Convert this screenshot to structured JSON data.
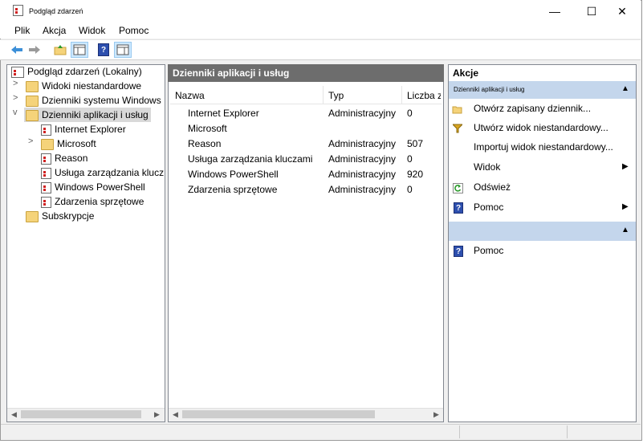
{
  "window": {
    "title": "Podgląd zdarzeń",
    "minimize_symbol": "—",
    "maximize_symbol": "☐",
    "close_symbol": "✕"
  },
  "menu": {
    "items": [
      "Plik",
      "Akcja",
      "Widok",
      "Pomoc"
    ]
  },
  "toolbar": {
    "icons": [
      "back-arrow-icon",
      "forward-arrow-icon",
      "up-folder-icon",
      "console-tree-icon",
      "help-icon",
      "show-hide-action-pane-icon"
    ]
  },
  "tree": {
    "root": "Podgląd zdarzeń (Lokalny)",
    "items": [
      {
        "label": "Widoki niestandardowe",
        "expander": ">"
      },
      {
        "label": "Dzienniki systemu Windows",
        "expander": ">"
      },
      {
        "label": "Dzienniki aplikacji i usług",
        "expander": "v"
      },
      {
        "label": "Internet Explorer"
      },
      {
        "label": "Microsoft",
        "expander": ">"
      },
      {
        "label": "Reason"
      },
      {
        "label": "Usługa zarządzania klucza"
      },
      {
        "label": "Windows PowerShell"
      },
      {
        "label": "Zdarzenia sprzętowe"
      },
      {
        "label": "Subskrypcje"
      }
    ]
  },
  "center": {
    "header": "Dzienniki aplikacji i usług",
    "columns": [
      "Nazwa",
      "Typ",
      "Liczba zd"
    ],
    "rows": [
      {
        "name": "Internet Explorer",
        "type": "Administracyjny",
        "count": "0"
      },
      {
        "name": "Microsoft",
        "type": "",
        "count": ""
      },
      {
        "name": "Reason",
        "type": "Administracyjny",
        "count": "507"
      },
      {
        "name": "Usługa zarządzania kluczami",
        "type": "Administracyjny",
        "count": "0"
      },
      {
        "name": "Windows PowerShell",
        "type": "Administracyjny",
        "count": "920"
      },
      {
        "name": "Zdarzenia sprzętowe",
        "type": "Administracyjny",
        "count": "0"
      }
    ]
  },
  "actions": {
    "title": "Akcje",
    "section1": "Dzienniki aplikacji i usług",
    "items": [
      {
        "label": "Otwórz zapisany dziennik...",
        "icon": "open-folder-icon"
      },
      {
        "label": "Utwórz widok niestandardowy...",
        "icon": "filter-icon"
      },
      {
        "label": "Importuj widok niestandardowy...",
        "icon": ""
      },
      {
        "label": "Widok",
        "icon": "",
        "submenu": "▶"
      },
      {
        "label": "Odśwież",
        "icon": "refresh-icon"
      },
      {
        "label": "Pomoc",
        "icon": "help-icon",
        "submenu": "▶"
      }
    ],
    "section2_items": [
      {
        "label": "Pomoc",
        "icon": "help-icon"
      }
    ],
    "collapse_symbol": "▲"
  },
  "colors": {
    "accent": "#c4d6ec",
    "selection": "#cce8ff",
    "header_bg": "#6d6d6d"
  }
}
